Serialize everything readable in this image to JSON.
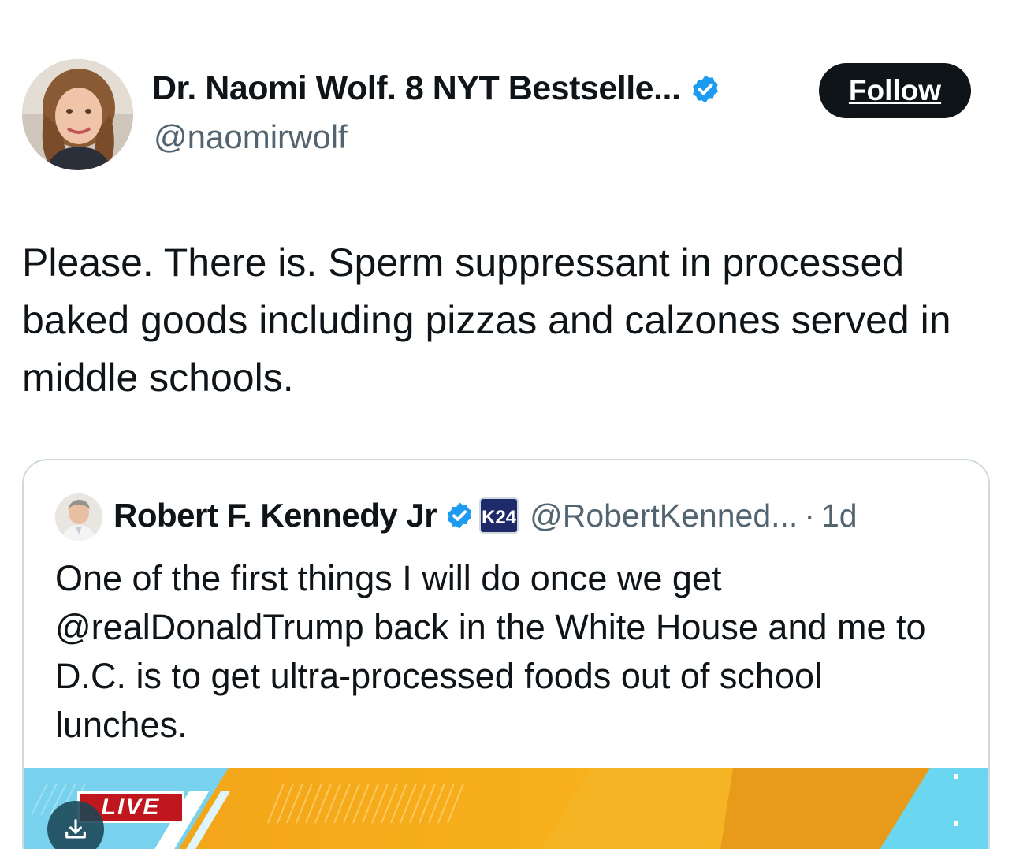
{
  "author": {
    "display_name": "Dr. Naomi Wolf. 8 NYT Bestselle...",
    "handle": "@naomirwolf",
    "avatar_icon": "profile-photo-woman"
  },
  "follow_button": {
    "label": "Follow"
  },
  "tweet": {
    "text": "Please. There is. Sperm suppressant in processed baked goods including pizzas and calzones served in middle schools."
  },
  "quoted_tweet": {
    "display_name": "Robert F. Kennedy Jr",
    "org_badge": "K24",
    "handle": "@RobertKenned...",
    "separator": "·",
    "time": "1d",
    "text": "One of the first things I will do once we get @realDonaldTrump back in the White House and me to D.C. is to get ultra-processed foods out of school lunches.",
    "media": {
      "live_label": "LIVE",
      "download_icon": "download-icon"
    }
  },
  "colors": {
    "text_primary": "#0f1419",
    "text_secondary": "#536471",
    "verified_blue": "#1d9bf0",
    "card_border": "#cfd9de",
    "follow_bg": "#0f1419",
    "live_red": "#c0161d",
    "media_orange": "#f7a81b",
    "media_cyan": "#5fd6ef"
  }
}
